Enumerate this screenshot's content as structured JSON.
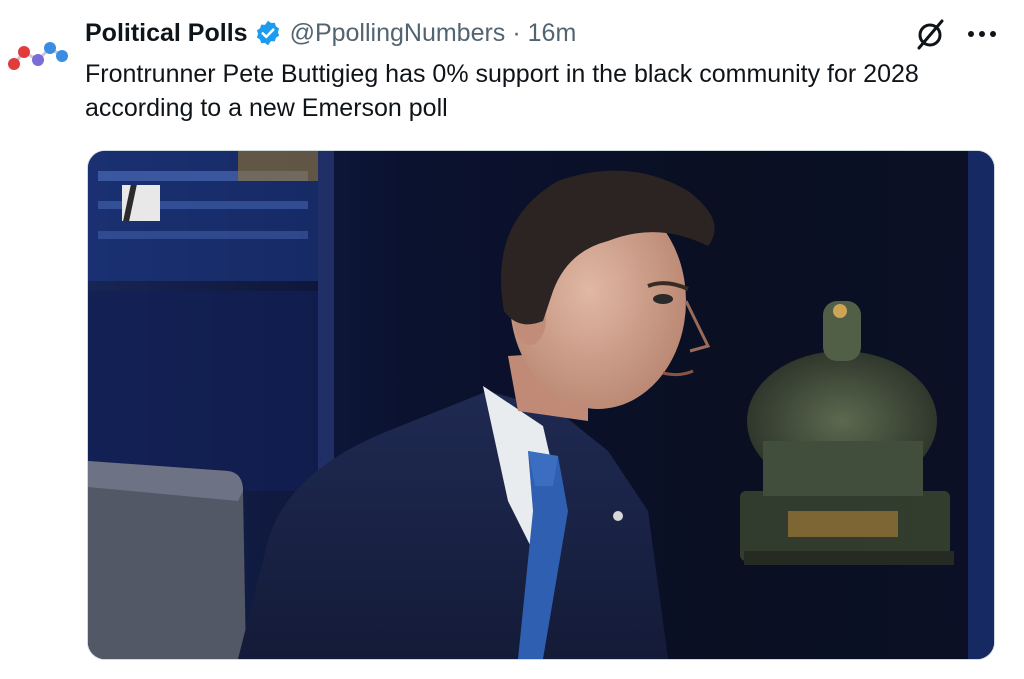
{
  "tweet": {
    "display_name": "Political Polls",
    "handle": "@PpollingNumbers",
    "separator": "·",
    "timestamp": "16m",
    "text": "Frontrunner Pete Buttigieg has 0% support in the black community for 2028 according to a new Emerson poll"
  },
  "icons": {
    "avatar": "political-polls-logo",
    "verified": "verified-badge-icon",
    "grok": "grok-icon",
    "more": "more-options-icon"
  },
  "colors": {
    "verified_blue": "#1d9bf0",
    "text_primary": "#0f1419",
    "text_secondary": "#536471"
  }
}
